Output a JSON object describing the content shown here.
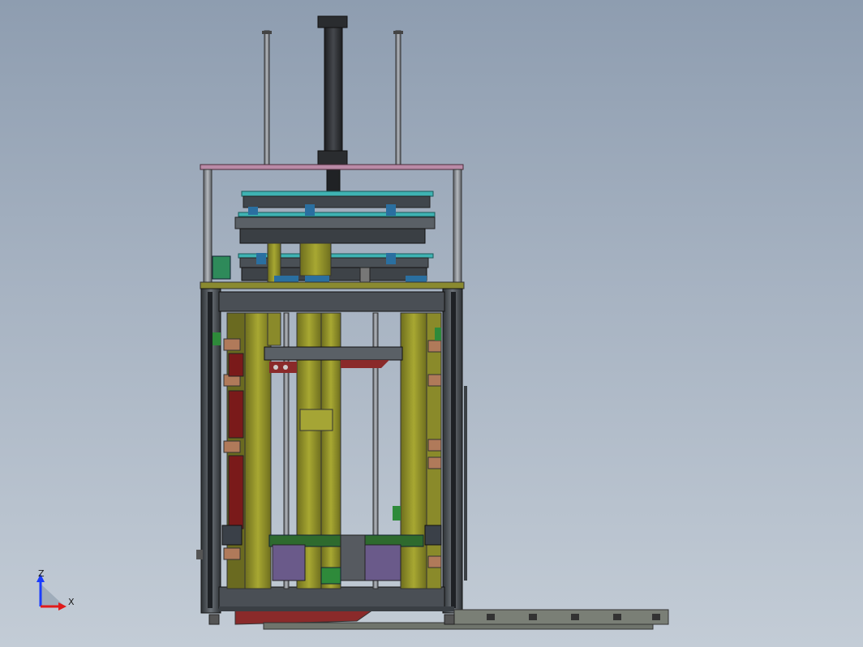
{
  "triad": {
    "z_label": "Z",
    "x_label": "X",
    "colors": {
      "z": "#1a3cff",
      "x": "#e01a1a",
      "y": "#1a9a1a"
    }
  },
  "colors": {
    "background_top": "#8e9db0",
    "background_bottom": "#c3ccd6",
    "frame": "#4a4f55",
    "olive": "#9a9a2a",
    "dark_olive": "#5c5c1a",
    "rod": "#7d8288",
    "cylinder": "#2b2d30",
    "teal_plate": "#2aa0a0",
    "pink_plate": "#b07090",
    "red_part": "#9a2a2a",
    "conveyor": "#6a6f66"
  }
}
